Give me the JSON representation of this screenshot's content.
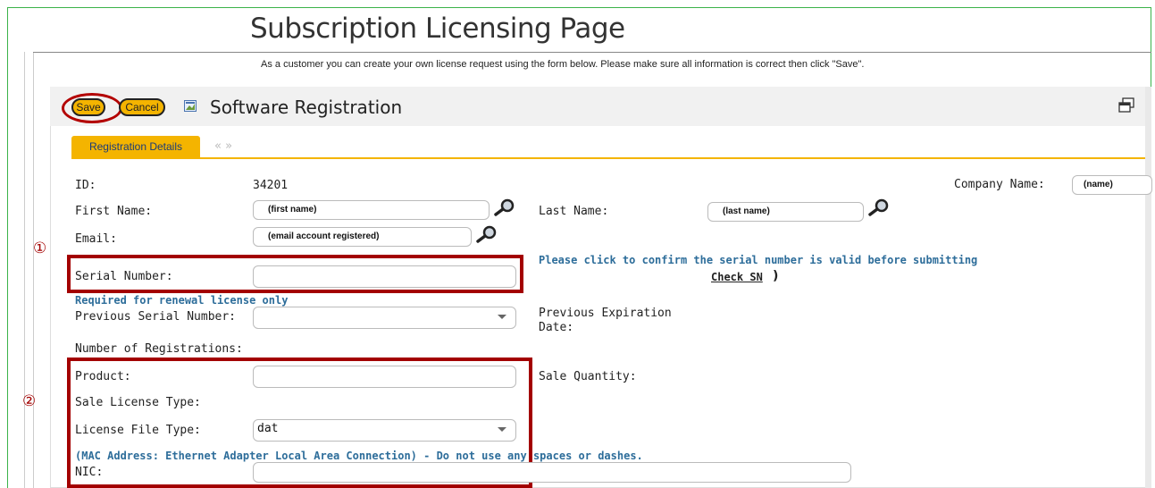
{
  "page": {
    "title": "Subscription Licensing Page",
    "intro": "As a customer you can create your own license request using the form below. Please make sure all information is correct then click \"Save\"."
  },
  "toolbar": {
    "save_label": "Save",
    "cancel_label": "Cancel",
    "form_title": "Software Registration"
  },
  "tabs": {
    "active_label": "Registration Details",
    "nav_arrows": "« »"
  },
  "form": {
    "id_label": "ID:",
    "id_value": "34201",
    "company_label": "Company Name:",
    "company_value": "(name)",
    "first_name_label": "First Name:",
    "first_name_value": "(first name)",
    "last_name_label": "Last Name:",
    "last_name_value": "(last name)",
    "email_label": "Email:",
    "email_value": "(email account registered)",
    "serial_label": "Serial Number:",
    "serial_value": "",
    "serial_note": "Please click to confirm the serial number is valid before submitting",
    "check_sn_label": "Check SN",
    "renewal_note": "Required for renewal license only",
    "prev_serial_label": "Previous Serial Number:",
    "prev_serial_value": "",
    "prev_exp_label_1": "Previous Expiration",
    "prev_exp_label_2": "Date:",
    "num_reg_label": "Number of Registrations:",
    "product_label": "Product:",
    "product_value": "",
    "sale_qty_label": "Sale Quantity:",
    "sale_license_label": "Sale License Type:",
    "license_file_label": "License File Type:",
    "license_file_value": "dat",
    "mac_note": "(MAC Address: Ethernet Adapter Local Area Connection) - Do not use any spaces or dashes.",
    "nic_label": "NIC:",
    "nic_value": ""
  },
  "annotations": {
    "marker_1": "①",
    "marker_2": "②"
  },
  "colors": {
    "accent_yellow": "#f4b400",
    "highlight_red": "#a30000",
    "note_blue": "#2d6d9a",
    "frame_green": "#3bb34a"
  },
  "icons": {
    "lookup": "magnifier-icon",
    "form": "registration-icon",
    "popout": "popout-icon"
  }
}
